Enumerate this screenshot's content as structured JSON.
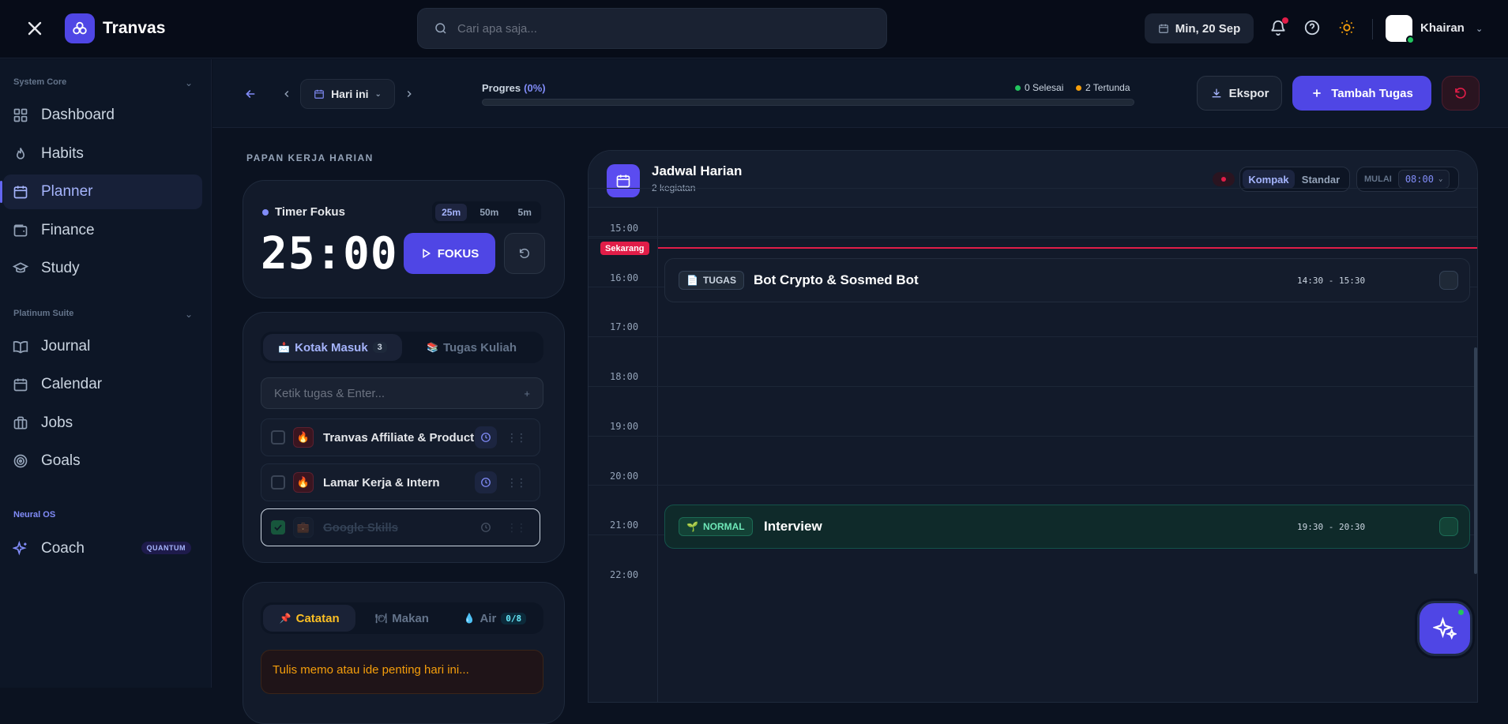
{
  "app": {
    "brand": "Tranvas"
  },
  "search": {
    "placeholder": "Cari apa saja..."
  },
  "header": {
    "date": "Min, 20 Sep",
    "user": "Khairan"
  },
  "sidebar": {
    "sections": [
      {
        "label": "System Core",
        "items": [
          "Dashboard",
          "Habits",
          "Planner",
          "Finance",
          "Study"
        ]
      },
      {
        "label": "Platinum Suite",
        "items": [
          "Journal",
          "Calendar",
          "Jobs",
          "Goals"
        ]
      },
      {
        "label": "Neural OS",
        "items": [
          "Coach"
        ],
        "badge": "QUANTUM"
      }
    ],
    "active": "Planner"
  },
  "toolbar": {
    "day": "Hari ini",
    "progress_label": "Progres",
    "progress_value": "(0%)",
    "progress_fraction": 0,
    "done": "0 Selesai",
    "pending": "2 Tertunda",
    "export": "Ekspor",
    "add": "Tambah Tugas"
  },
  "board": {
    "title": "PAPAN KERJA HARIAN",
    "timer": {
      "title": "Timer Fokus",
      "durations": [
        "25m",
        "50m",
        "5m"
      ],
      "selected": "25m",
      "time": "25:00",
      "focus": "FOKUS"
    },
    "tasks": {
      "tabs": [
        {
          "label": "Kotak Masuk",
          "count": "3"
        },
        {
          "label": "Tugas Kuliah"
        }
      ],
      "placeholder": "Ketik tugas & Enter...",
      "plus": "+",
      "items": [
        {
          "name": "Tranvas Affiliate & Product Hunt",
          "done": false
        },
        {
          "name": "Lamar Kerja & Intern",
          "done": false
        },
        {
          "name": "Google Skills",
          "done": true
        }
      ]
    },
    "notes": {
      "tabs": [
        {
          "label": "Catatan"
        },
        {
          "label": "Makan"
        },
        {
          "label": "Air",
          "count": "0/8"
        }
      ],
      "placeholder": "Tulis memo atau ide penting hari ini..."
    }
  },
  "schedule": {
    "title": "Jadwal Harian",
    "subtitle": "2 kegiatan",
    "views": [
      "Kompak",
      "Standar"
    ],
    "active_view": "Kompak",
    "start_label": "MULAI",
    "start_value": "08:00",
    "now_label": "Sekarang",
    "hours": [
      "15:00",
      "16:00",
      "17:00",
      "18:00",
      "19:00",
      "20:00",
      "21:00",
      "22:00"
    ],
    "events": [
      {
        "tag": "TUGAS",
        "name": "Bot Crypto & Sosmed Bot",
        "time": "14:30 - 15:30"
      },
      {
        "tag": "NORMAL",
        "name": "Interview",
        "time": "19:30 - 20:30"
      }
    ]
  },
  "colors": {
    "accent": "#4f46e5",
    "danger": "#e11d48",
    "success": "#22c55e",
    "warning": "#f59e0b"
  }
}
